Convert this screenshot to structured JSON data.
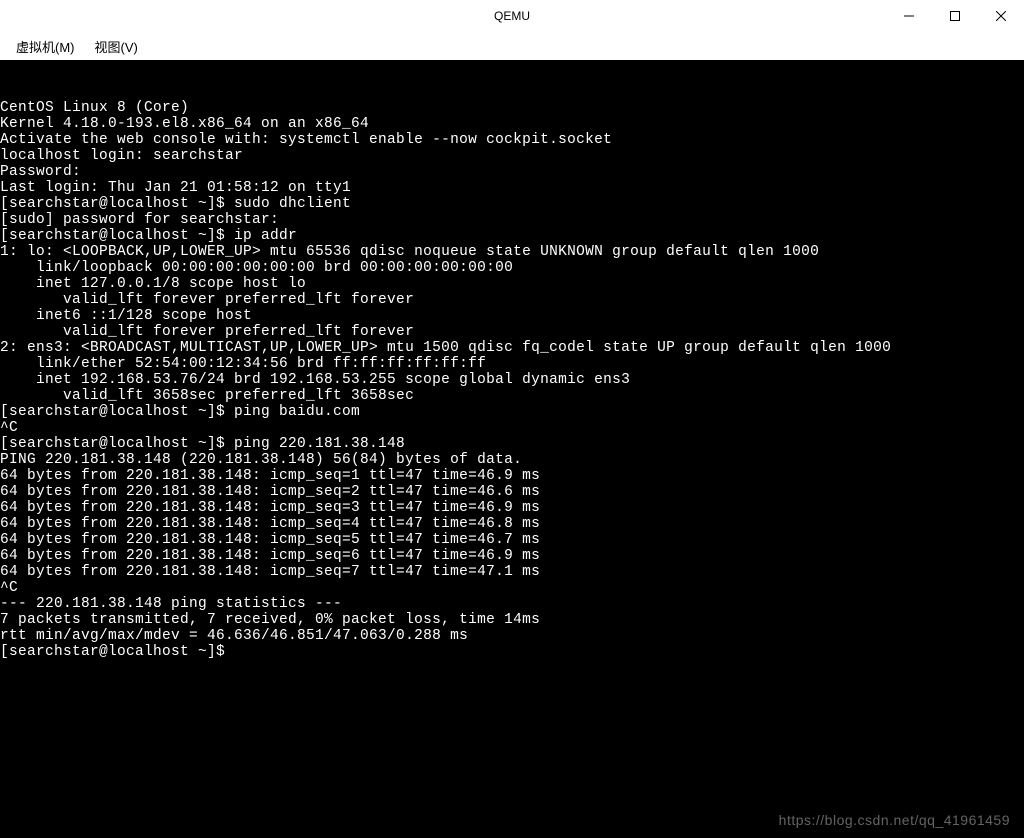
{
  "window": {
    "title": "QEMU"
  },
  "menu": {
    "vm": "虚拟机(M)",
    "view": "视图(V)"
  },
  "terminal": {
    "lines": [
      "CentOS Linux 8 (Core)",
      "Kernel 4.18.0-193.el8.x86_64 on an x86_64",
      "",
      "Activate the web console with: systemctl enable --now cockpit.socket",
      "",
      "localhost login: searchstar",
      "Password:",
      "Last login: Thu Jan 21 01:58:12 on tty1",
      "[searchstar@localhost ~]$ sudo dhclient",
      "[sudo] password for searchstar:",
      "[searchstar@localhost ~]$ ip addr",
      "1: lo: <LOOPBACK,UP,LOWER_UP> mtu 65536 qdisc noqueue state UNKNOWN group default qlen 1000",
      "    link/loopback 00:00:00:00:00:00 brd 00:00:00:00:00:00",
      "    inet 127.0.0.1/8 scope host lo",
      "       valid_lft forever preferred_lft forever",
      "    inet6 ::1/128 scope host",
      "       valid_lft forever preferred_lft forever",
      "2: ens3: <BROADCAST,MULTICAST,UP,LOWER_UP> mtu 1500 qdisc fq_codel state UP group default qlen 1000",
      "    link/ether 52:54:00:12:34:56 brd ff:ff:ff:ff:ff:ff",
      "    inet 192.168.53.76/24 brd 192.168.53.255 scope global dynamic ens3",
      "       valid_lft 3658sec preferred_lft 3658sec",
      "[searchstar@localhost ~]$ ping baidu.com",
      "^C",
      "[searchstar@localhost ~]$ ping 220.181.38.148",
      "PING 220.181.38.148 (220.181.38.148) 56(84) bytes of data.",
      "64 bytes from 220.181.38.148: icmp_seq=1 ttl=47 time=46.9 ms",
      "64 bytes from 220.181.38.148: icmp_seq=2 ttl=47 time=46.6 ms",
      "64 bytes from 220.181.38.148: icmp_seq=3 ttl=47 time=46.9 ms",
      "64 bytes from 220.181.38.148: icmp_seq=4 ttl=47 time=46.8 ms",
      "64 bytes from 220.181.38.148: icmp_seq=5 ttl=47 time=46.7 ms",
      "64 bytes from 220.181.38.148: icmp_seq=6 ttl=47 time=46.9 ms",
      "64 bytes from 220.181.38.148: icmp_seq=7 ttl=47 time=47.1 ms",
      "^C",
      "--- 220.181.38.148 ping statistics ---",
      "7 packets transmitted, 7 received, 0% packet loss, time 14ms",
      "rtt min/avg/max/mdev = 46.636/46.851/47.063/0.288 ms",
      "[searchstar@localhost ~]$ "
    ]
  },
  "watermark": {
    "text": "https://blog.csdn.net/qq_41961459"
  }
}
